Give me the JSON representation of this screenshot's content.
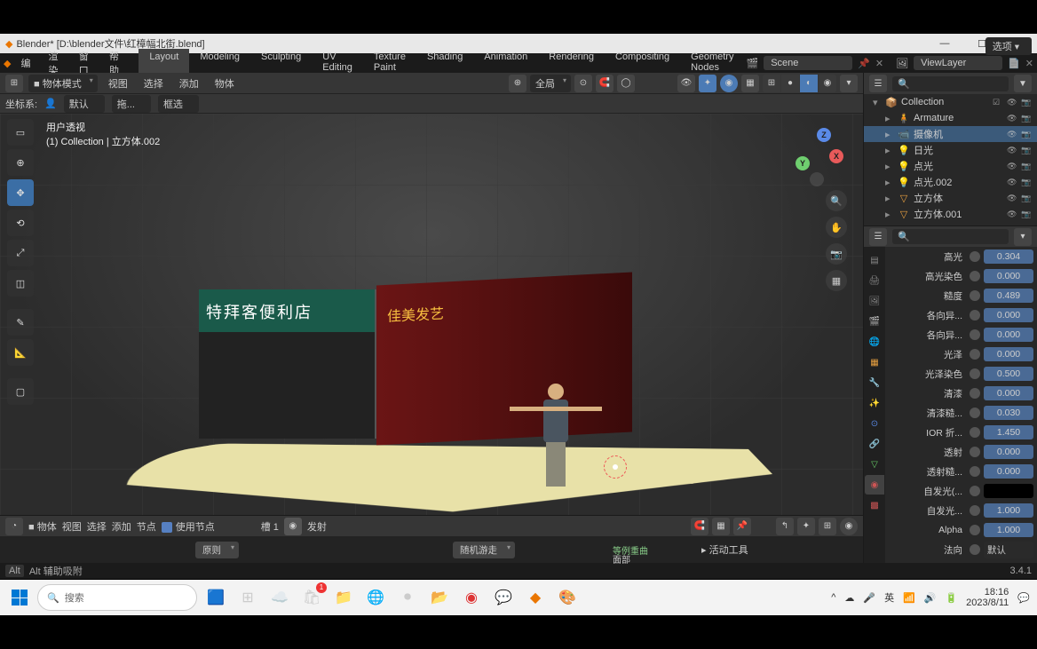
{
  "titlebar": {
    "title": "Blender* [D:\\blender文件\\红樟幅北街.blend]"
  },
  "topmenu": {
    "items": [
      "编",
      "渲染",
      "窗口",
      "帮助"
    ],
    "workspaces": [
      "Layout",
      "Modeling",
      "Sculpting",
      "UV Editing",
      "Texture Paint",
      "Shading",
      "Animation",
      "Rendering",
      "Compositing",
      "Geometry Nodes"
    ],
    "scene_label": "Scene",
    "viewlayer_label": "ViewLayer"
  },
  "view_header": {
    "mode": "物体模式",
    "menus": [
      "视图",
      "选择",
      "添加",
      "物体"
    ],
    "global": "全局",
    "options_btn": "选项"
  },
  "view_subheader": {
    "coord_label": "坐标系:",
    "coord_val": "默认",
    "drag": "拖...",
    "rot": "框选"
  },
  "overlay": {
    "line1": "用户透视",
    "line2": "(1) Collection | 立方体.002"
  },
  "scene_signs": {
    "store": "特拜客便利店",
    "salon": "佳美发艺"
  },
  "node_editor": {
    "type": "物体",
    "menus": [
      "视图",
      "选择",
      "添加",
      "节点"
    ],
    "use_nodes": "使用节点",
    "slot": "槽 1",
    "mat": "发射",
    "panel1": "活动工具",
    "label_hint1": "等例重曲",
    "label_hint2": "面部",
    "drop1": "原则",
    "drop2": "随机游走"
  },
  "outliner": {
    "search_placeholder": "",
    "tree": [
      {
        "indent": 0,
        "icon": "📦",
        "label": "Collection",
        "toggles": [
          "☑",
          "👁",
          "📷"
        ]
      },
      {
        "indent": 1,
        "icon": "🧍",
        "label": "Armature",
        "toggles": [
          "👁",
          "📷"
        ],
        "color": "#d88"
      },
      {
        "indent": 1,
        "icon": "📹",
        "label": "摄像机",
        "toggles": [
          "👁",
          "📷"
        ],
        "color": "#8c8",
        "hl": true
      },
      {
        "indent": 1,
        "icon": "💡",
        "label": "日光",
        "toggles": [
          "👁",
          "📷"
        ],
        "color": "#e8a040"
      },
      {
        "indent": 1,
        "icon": "💡",
        "label": "点光",
        "toggles": [
          "👁",
          "📷"
        ],
        "color": "#e8a040"
      },
      {
        "indent": 1,
        "icon": "💡",
        "label": "点光.002",
        "toggles": [
          "👁",
          "📷"
        ],
        "color": "#e8a040"
      },
      {
        "indent": 1,
        "icon": "▽",
        "label": "立方体",
        "toggles": [
          "👁",
          "📷"
        ],
        "color": "#e8a040"
      },
      {
        "indent": 1,
        "icon": "▽",
        "label": "立方体.001",
        "toggles": [
          "👁",
          "📷"
        ],
        "color": "#e8a040"
      }
    ]
  },
  "props": [
    {
      "label": "高光",
      "val": "0.304",
      "type": "num"
    },
    {
      "label": "高光染色",
      "val": "0.000",
      "type": "num"
    },
    {
      "label": "糙度",
      "val": "0.489",
      "type": "num"
    },
    {
      "label": "各向异...",
      "val": "0.000",
      "type": "num"
    },
    {
      "label": "各向异...",
      "val": "0.000",
      "type": "num"
    },
    {
      "label": "光泽",
      "val": "0.000",
      "type": "num"
    },
    {
      "label": "光泽染色",
      "val": "0.500",
      "type": "num"
    },
    {
      "label": "清漆",
      "val": "0.000",
      "type": "num"
    },
    {
      "label": "清漆糙...",
      "val": "0.030",
      "type": "num"
    },
    {
      "label": "IOR 折...",
      "val": "1.450",
      "type": "num"
    },
    {
      "label": "透射",
      "val": "0.000",
      "type": "num"
    },
    {
      "label": "透射糙...",
      "val": "0.000",
      "type": "num"
    },
    {
      "label": "自发光(...",
      "val": "",
      "type": "color"
    },
    {
      "label": "自发光...",
      "val": "1.000",
      "type": "num"
    },
    {
      "label": "Alpha",
      "val": "1.000",
      "type": "num"
    },
    {
      "label": "法向",
      "val": "默认",
      "type": "drop"
    }
  ],
  "status": {
    "left": "Alt  辅助吸附",
    "version": "3.4.1"
  },
  "taskbar": {
    "search": "搜索",
    "time": "18:16",
    "date": "2023/8/11",
    "ime": "英"
  }
}
